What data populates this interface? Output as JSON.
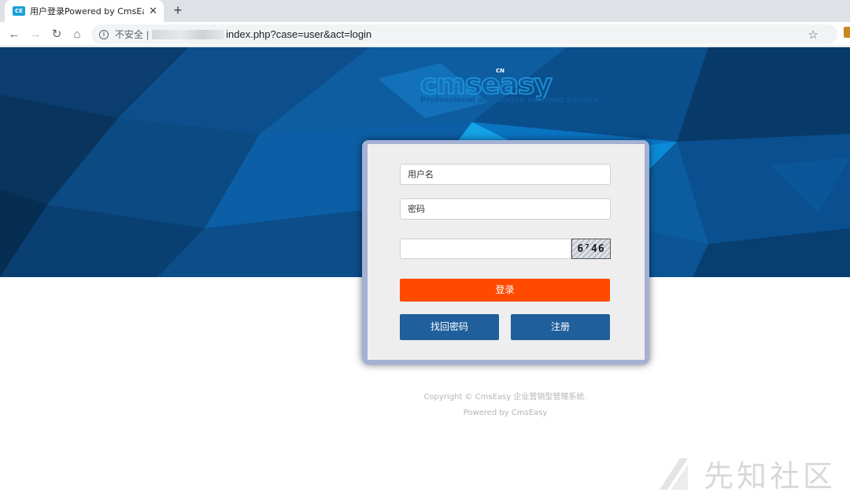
{
  "browser": {
    "tab": {
      "favicon_text": "CE",
      "title": "用户登录Powered by CmsEasy",
      "close_glyph": "✕"
    },
    "new_tab_glyph": "+",
    "nav": {
      "back": "←",
      "forward": "→",
      "reload": "↻",
      "home": "⌂"
    },
    "omnibox": {
      "info_glyph": "i",
      "security_text": "不安全",
      "separator": "|",
      "url": "index.php?case=user&act=login"
    },
    "bookmark_glyph": "☆"
  },
  "logo": {
    "text": "cmseasy",
    "cn_badge": "CN",
    "tagline": "Professional and stable Internet Service"
  },
  "login": {
    "username_placeholder": "用户名",
    "password_placeholder": "密码",
    "captcha_code": "6⁷46",
    "login_button": "登录",
    "forgot_button": "找回密码",
    "register_button": "注册"
  },
  "footer": {
    "copyright": "Copyright © CmsEasy 企业营销型管理系统.",
    "powered": "Powered by CmsEasy"
  },
  "watermark": {
    "text": "先知社区"
  },
  "colors": {
    "hero_bg": "#0a4d86",
    "login_button": "#ff4a00",
    "secondary_button": "#1f5f9c",
    "frame": "#a4b1d4"
  }
}
